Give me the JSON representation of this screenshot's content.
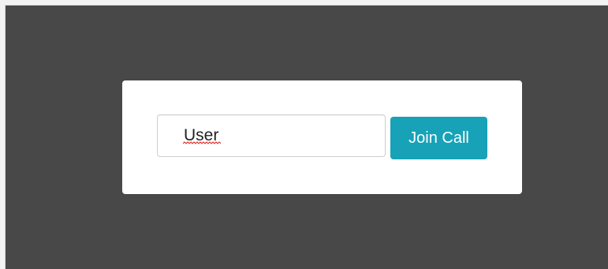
{
  "join_form": {
    "name_input_value": "User",
    "join_button_label": "Join Call"
  },
  "colors": {
    "page_background": "#484848",
    "card_background": "#ffffff",
    "button_background": "#17a2b8",
    "spellcheck_underline": "#e02020"
  }
}
